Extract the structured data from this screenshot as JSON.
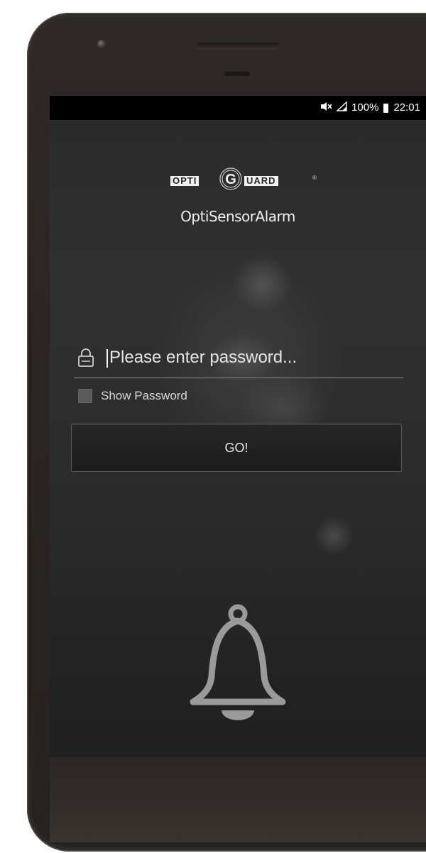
{
  "status_bar": {
    "icons": [
      "mute-icon",
      "signal-icon",
      "battery-icon"
    ],
    "battery": "100%",
    "time": "22:01"
  },
  "branding": {
    "logo_left": "OPTI",
    "logo_right": "UARD",
    "logo_mark": "G",
    "registered": "®",
    "app_name": "OptiSensorAlarm"
  },
  "login": {
    "password_placeholder": "Please enter password...",
    "password_value": "",
    "show_password_label": "Show Password",
    "show_password_checked": false,
    "submit_label": "GO!"
  },
  "illustration": {
    "icon": "bell-icon"
  },
  "colors": {
    "screen_bg": "#2b2b2b",
    "status_bar_bg": "#000000",
    "text_primary": "#f0f0f0",
    "bell": "#9a9a9a",
    "phone_body": "#2b2624"
  }
}
